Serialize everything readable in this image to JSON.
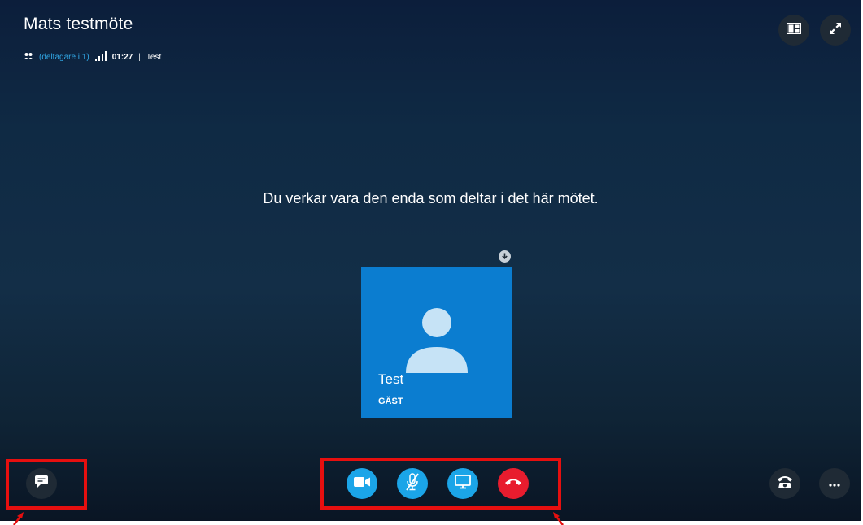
{
  "meeting": {
    "title": "Mats testmöte",
    "participants": "(deltagare i 1)",
    "duration": "01:27",
    "separator": "|",
    "user": "Test"
  },
  "stage": {
    "message": "Du verkar vara den enda som deltar i det här mötet."
  },
  "participant_tile": {
    "name": "Test",
    "role": "GÄST"
  },
  "icons": {
    "participants": "participants-icon",
    "signal": "signal-strength-icon",
    "layout": "layout-icon",
    "fullscreen": "fullscreen-icon",
    "download": "download-icon",
    "chat": "chat-icon",
    "video": "video-camera-icon",
    "mic_muted": "microphone-muted-icon",
    "share_screen": "screen-share-icon",
    "hang_up": "hang-up-icon",
    "dialpad": "phone-icon",
    "more": "more-options-icon"
  },
  "colors": {
    "accent_blue": "#1ba5e8",
    "hangup_red": "#e81c2e",
    "tile_blue": "#0b7dd0",
    "highlight_red": "#e60f0f",
    "participants_link": "#31a8e6"
  }
}
